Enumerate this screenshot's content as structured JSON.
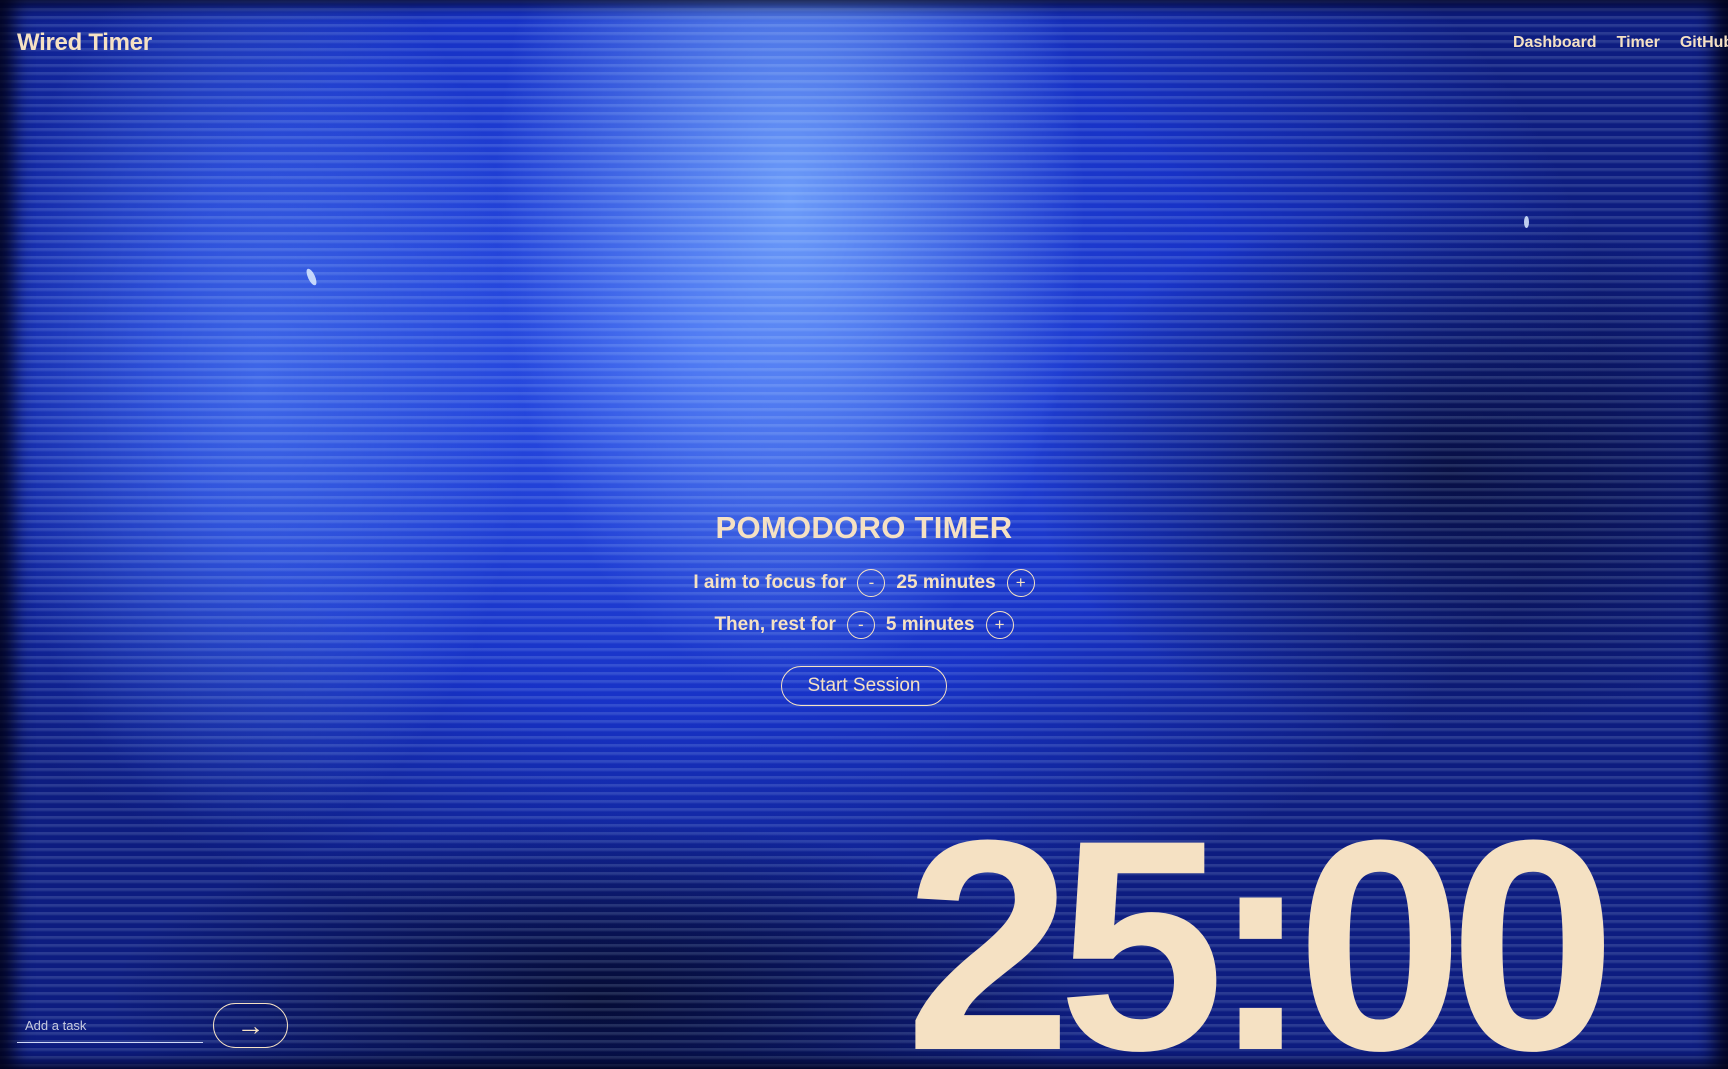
{
  "app": {
    "title": "Wired Timer"
  },
  "nav": {
    "items": [
      "Dashboard",
      "Timer",
      "GitHub"
    ]
  },
  "timer": {
    "heading": "POMODORO TIMER",
    "focus": {
      "label": "I aim to focus for",
      "decrement": "-",
      "value": "25 minutes",
      "increment": "+"
    },
    "rest": {
      "label": "Then, rest for",
      "decrement": "-",
      "value": "5 minutes",
      "increment": "+"
    },
    "start_label": "Start Session",
    "display": "25:00"
  },
  "task": {
    "placeholder": "Add a task",
    "submit_icon": "→"
  },
  "colors": {
    "accent": "#f5e1c3",
    "background": "#1a36d0"
  }
}
